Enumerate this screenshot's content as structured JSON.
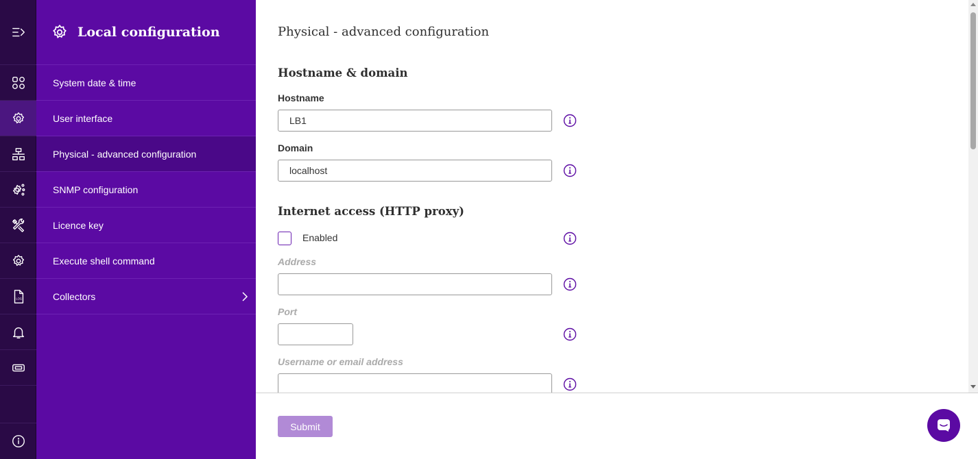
{
  "rail": {
    "icons": [
      "menu-toggle-icon",
      "dashboard-icon",
      "config-gear-icon",
      "network-icon",
      "gear-share-icon",
      "tools-icon",
      "settings-icon",
      "log-file-icon",
      "bell-icon",
      "ticket-icon",
      "info-icon"
    ],
    "log_icon_text": "LOG"
  },
  "menu": {
    "title": "Local configuration",
    "items": [
      {
        "label": "System date & time"
      },
      {
        "label": "User interface"
      },
      {
        "label": "Physical - advanced configuration"
      },
      {
        "label": "SNMP configuration"
      },
      {
        "label": "Licence key"
      },
      {
        "label": "Execute shell command"
      },
      {
        "label": "Collectors"
      }
    ]
  },
  "main": {
    "page_title": "Physical - advanced configuration",
    "hostname_section": {
      "title": "Hostname & domain",
      "hostname_label": "Hostname",
      "hostname_value": "LB1",
      "domain_label": "Domain",
      "domain_value": "localhost"
    },
    "proxy_section": {
      "title": "Internet access (HTTP proxy)",
      "enabled_label": "Enabled",
      "address_label": "Address",
      "port_label": "Port",
      "username_label": "Username or email address"
    }
  },
  "footer": {
    "submit_label": "Submit"
  },
  "colors": {
    "rail_bg": "#2a0a46",
    "menu_bg": "#5b0aa3",
    "menu_active": "#4a0888",
    "accent": "#6a1fb0",
    "submit_bg": "#b18ad6"
  }
}
